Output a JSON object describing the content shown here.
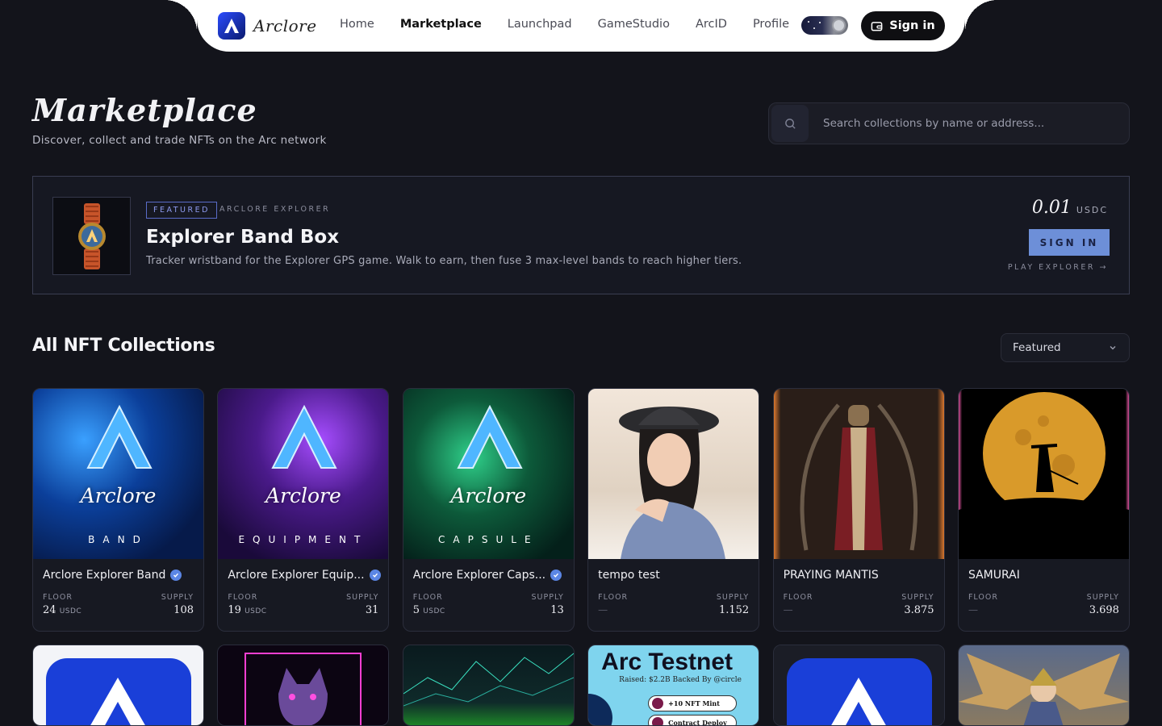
{
  "nav": {
    "brand": "Arclore",
    "links": [
      "Home",
      "Marketplace",
      "Launchpad",
      "GameStudio",
      "ArcID",
      "Profile"
    ],
    "active": "Marketplace",
    "signin_label": "Sign in"
  },
  "header": {
    "title": "Marketplace",
    "subtitle": "Discover, collect and trade NFTs on the Arc network",
    "search_placeholder": "Search collections by name or address..."
  },
  "featured": {
    "badge": "FEATURED",
    "collection": "ARCLORE EXPLORER",
    "title": "Explorer Band Box",
    "description": "Tracker wristband for the Explorer GPS game. Walk to earn, then fuse 3 max-level bands to reach higher tiers.",
    "price": "0.01",
    "price_unit": "USDC",
    "signin_label": "SIGN IN",
    "play_label": "PLAY EXPLORER →"
  },
  "collections": {
    "title": "All NFT Collections",
    "sort_value": "Featured",
    "floor_label": "FLOOR",
    "supply_label": "SUPPLY",
    "items": [
      {
        "name": "Arclore Explorer Band",
        "verified": true,
        "floor": "24",
        "unit": "USDC",
        "supply": "108",
        "art_title": "Arclore",
        "art_sub": "BAND"
      },
      {
        "name": "Arclore Explorer Equip...",
        "verified": true,
        "floor": "19",
        "unit": "USDC",
        "supply": "31",
        "art_title": "Arclore",
        "art_sub": "EQUIPMENT"
      },
      {
        "name": "Arclore Explorer Caps...",
        "verified": true,
        "floor": "5",
        "unit": "USDC",
        "supply": "13",
        "art_title": "Arclore",
        "art_sub": "CAPSULE"
      },
      {
        "name": "tempo test",
        "verified": false,
        "floor": "—",
        "unit": "",
        "supply": "1.152"
      },
      {
        "name": "PRAYING MANTIS",
        "verified": false,
        "floor": "—",
        "unit": "",
        "supply": "3.875"
      },
      {
        "name": "SAMURAI",
        "verified": false,
        "floor": "—",
        "unit": "",
        "supply": "3.698"
      }
    ],
    "row2": {
      "testnet_title": "Arc Testnet",
      "testnet_sub": "Raised: $2.2B Backed By @circle",
      "testnet_pill1": "+10 NFT Mint",
      "testnet_pill2": "Contract Deploy"
    }
  },
  "colors": {
    "background": "#13141b",
    "accent": "#6d8fd8",
    "verified": "#5b86e5"
  }
}
